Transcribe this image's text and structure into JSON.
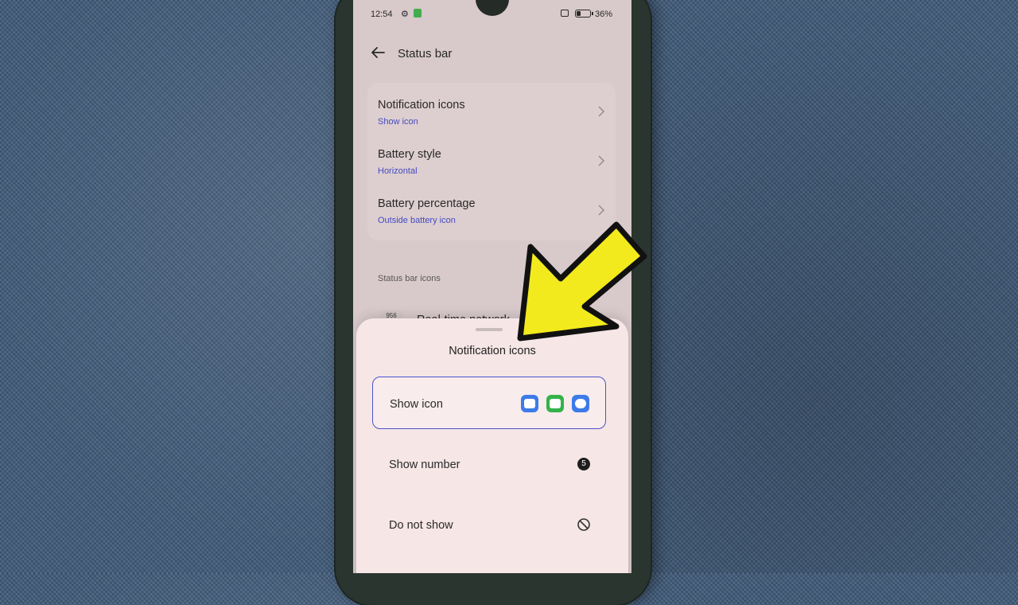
{
  "statusbar": {
    "time": "12:54",
    "battery_pct": "36%",
    "battery_level": 0.36,
    "gear_icon": "gear-icon",
    "lock_icon": "lock-icon",
    "nfc_icon": "nfc-icon",
    "battery_icon": "battery-icon"
  },
  "header": {
    "title": "Status bar",
    "back_icon": "back-arrow-icon"
  },
  "settings": [
    {
      "title": "Notification icons",
      "value": "Show icon"
    },
    {
      "title": "Battery style",
      "value": "Horizontal"
    },
    {
      "title": "Battery percentage",
      "value": "Outside battery icon"
    }
  ],
  "section": {
    "label": "Status bar icons",
    "partial_badge": "956",
    "partial_title": "Real-time network"
  },
  "sheet": {
    "title": "Notification icons",
    "options": [
      {
        "label": "Show icon",
        "selected": true,
        "icon": "app-icons"
      },
      {
        "label": "Show number",
        "selected": false,
        "icon": "count-badge",
        "badge": "5"
      },
      {
        "label": "Do not show",
        "selected": false,
        "icon": "block-icon"
      }
    ]
  },
  "colors": {
    "accent": "#4a55c9",
    "value_text": "#3f47c8",
    "arrow_yellow": "#f2ea1c",
    "app_blue": "#3d7be8",
    "app_green": "#35b24a"
  },
  "annotation": {
    "arrow_icon": "pointer-arrow-icon"
  }
}
